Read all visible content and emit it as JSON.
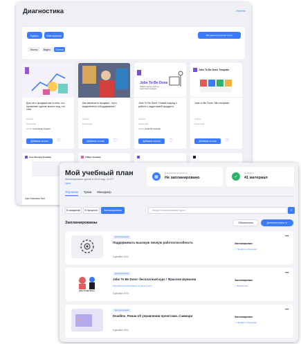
{
  "back": {
    "title": "Диагностика",
    "top_link": "Перейти",
    "filters": {
      "courses": "Курсы",
      "materials": "Материалы",
      "right_button": "Все диагностические тесты"
    },
    "chips": [
      "Тексты",
      "Видео",
      "Статьи"
    ],
    "cards": [
      {
        "title": "Для чего продажи как стоить, что проявляет сделке можно под, что тать.",
        "meta1": "Статья",
        "meta2": "Категории",
        "author_label": "Автор",
        "author": "Александр Кудаев",
        "btn": "Добавить в план"
      },
      {
        "title": "Как увеличить продажи - пути выделенного оборудования?",
        "meta1": "Статья",
        "meta2": "Категории",
        "author_label": "Автор",
        "author": "",
        "btn": "Добавить в план"
      },
      {
        "title": "Jobs To Be Done. Новый подход к работе с аудиторией продукта",
        "meta1": "Статья",
        "meta2": "Категории",
        "author_label": "Автор",
        "author": "Анна Бутрынова",
        "btn": "Добавить в план",
        "img_title": "Jobs To Be Done",
        "img_sub": "Новый подход к работе с аудиторией продукта"
      },
      {
        "title": "Jobs to Be Done: Miro template",
        "meta1": "Статья",
        "meta2": "Категории",
        "author_label": "Автор",
        "author": "",
        "btn": "Добавить в план",
        "img_title": "Jobs To Be Done Template"
      }
    ],
    "bottom_cards": [
      {
        "img_title": "User Interview Template",
        "side_label": "User Interview Tem"
      },
      {
        "img_title": "5 Ways Template"
      },
      {
        "img_title": ""
      },
      {
        "img_title": ""
      }
    ]
  },
  "front": {
    "title": "Мой учебный план",
    "subtitle": "Запланировано курсов в 2014 году: 41 6 Р",
    "subtitle_link": "Цель",
    "stat1": {
      "label": "Ближайшая активность",
      "value": "Не запланировано"
    },
    "stat2": {
      "label": "Пройдено",
      "value": "41 материал"
    },
    "tabs": [
      "Обучение",
      "Треки",
      "Менеджер"
    ],
    "segments": [
      "В ожидании",
      "В процессе",
      "Запланировано"
    ],
    "search_placeholder": "Введите наименование курса",
    "section_title": "Запланированы",
    "sec_buttons": [
      "Обязательно",
      "Дополнительно ✕"
    ],
    "rows": [
      {
        "tag": "Дополнительная",
        "title": "Поддерживать высокую личную работоспособность",
        "meta": "",
        "date": "5 декабря 2024",
        "status": "Запланирован",
        "action": "✓ Перейти к обучению",
        "dots": "•••"
      },
      {
        "tag": "Дополнительная",
        "title": "Jobs To Be Done: бесплатный курс / Фраслов Шувалов",
        "meta": "https://blog.education/jobs-to-be-done-course",
        "date": "5 декабря 2024",
        "status": "Запланирован",
        "action": "✓ Записаться",
        "dots": "•••",
        "thumb_text": "Jobs To Be Done"
      },
      {
        "tag": "Дополнительная",
        "title": "Deadline. Роман об управлении проектами. Саммари",
        "meta": "",
        "date": "5 декабря 2024",
        "status": "Запланирован",
        "action": "✓ Перейти к обучению",
        "dots": "•••",
        "thumb_text": "30..."
      }
    ]
  },
  "colors": {
    "accent": "#3a7bff",
    "green": "#2db36b"
  }
}
